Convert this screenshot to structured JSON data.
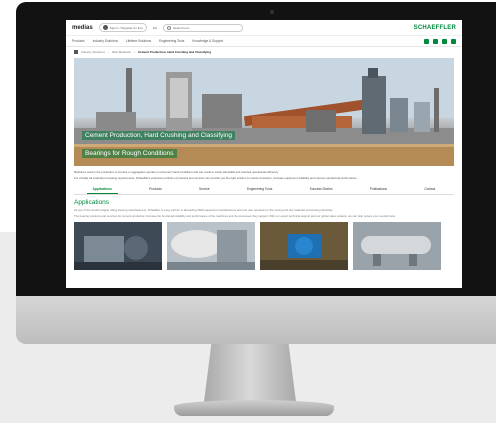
{
  "site": {
    "logo_text": "medias",
    "user_menu": "Sign in / Register for free",
    "language": "EN",
    "search_placeholder": "Search term",
    "brand": "SCHAEFFLER"
  },
  "nav": {
    "items": [
      "Products",
      "Industry Solutions",
      "Lifetime Solutions",
      "Engineering Tools",
      "Knowledge & Support"
    ],
    "icons": [
      "user-icon",
      "heart-icon",
      "document-icon",
      "cart-icon"
    ]
  },
  "breadcrumb": [
    "Industry Solutions",
    "Raw Materials",
    "Cement Production, Hard Crushing and Classifying"
  ],
  "hero": {
    "title_line1": "Cement Production, Hard Crushing and Classifying",
    "title_line2": "Bearings for Rough Conditions"
  },
  "intro": {
    "p1": "Machines used in the production of cement or aggregates operate in extremely harsh conditions that can result in costly standstills and reduced operational efficiency.",
    "p2": "For virtually all material processing requirements, Schaeffler's extensive portfolio of products and services can provide you the right solution to reduce downtime, increase equipment reliability and improve operational performance."
  },
  "tabs": [
    "Applications",
    "Products",
    "Service",
    "Engineering Tools",
    "Success Stories",
    "Publications",
    "Contact"
  ],
  "applications": {
    "title": "Applications",
    "text1": "As one of the world's largest rolling bearing manufacturers, Schaeffler is a key partner to all leading OEM equipment manufacturers and end user operators in the mining and raw materials processing industries.",
    "text2": "The bearing solutions and services for cement production increase the functional reliability and performance of the machines and the processes they support. With our expert technical support and our global sales network, we can help reduce your overall costs."
  },
  "colors": {
    "brand_green": "#00893d",
    "bezel": "#121212"
  }
}
